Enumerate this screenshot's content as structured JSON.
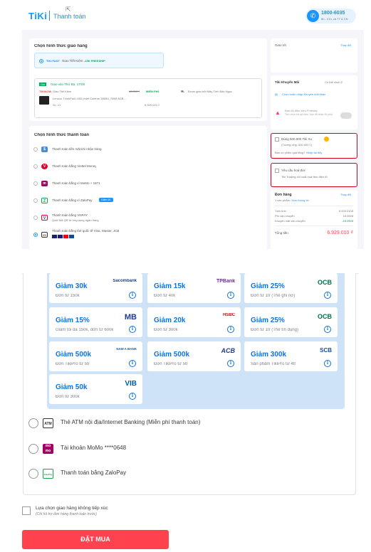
{
  "header": {
    "logo": "TiKi",
    "page_title": "Thanh toán",
    "hotline_number": "1800-6035",
    "hotline_sub": "8h - 21h, cả T7 & CN"
  },
  "shipping": {
    "title": "Chọn hình thức giao hàng",
    "method_brand": "TIKI FAST",
    "method_label": "Giao Tiết Kiệm",
    "method_discount": "-15K FREESHIP",
    "package": {
      "badge": "Gói",
      "date_label": "Giao vào Thứ Ba, 17/05",
      "brand": "TIKINOW",
      "ship_label": "Giao Tiết Kiệm",
      "ship_price": "18.000 ₫",
      "ship_free": "MIỄN PHÍ",
      "product_name": "Lenovo ThinkPad L460 (Intel Celeron 3865U, RAM 8GB,...",
      "qty": "SL: x1",
      "product_price": "6.929.010 ₫",
      "combine_note": "Được giao bởi Mây Tính Bảo Ngọc"
    }
  },
  "payment": {
    "title": "Chọn hình thức thanh toán",
    "methods": [
      {
        "label": "Thanh toán tiền mặt khi nhận hàng"
      },
      {
        "label": "Thanh toán bằng Viettel Money"
      },
      {
        "label": "Thanh toán bằng ví MoMo + 1871"
      },
      {
        "label": "Thanh toán bằng ví ZaloPay",
        "tag": "Giảm 1K"
      },
      {
        "label": "Thanh toán bằng VNPAY",
        "sub": "Quét Mã QR từ ứng dụng ngân hàng"
      },
      {
        "label": "Thanh toán bằng thẻ quốc tế Visa, Master, JCB"
      }
    ]
  },
  "right": {
    "ship_to_title": "Giao tới",
    "change": "Thay đổi",
    "promo_title": "Tiki Khuyến Mãi",
    "promo_count": "Có thể chọn 2",
    "promo_link": "Chọn hoặc nhập Khuyến mãi khác",
    "freeship_text": "Bạn đủ điều kiện Freeship",
    "freeship_sub": "Thử chọn khi gửi tiền, bạn đã nhận 90 phút",
    "tiki_xu_label": "Dùng 500.000 Tiki Xu",
    "tiki_xu_sub": "(Tương ứng: 500.000 ₫)",
    "gift_note": "Bạn có phiếu quà tặng?",
    "gift_link": "Nhập tại đây",
    "invoice_label": "Yêu cầu hoá đơn",
    "invoice_sub": "Tiki Trading chỉ xuất hoá đơn điện tử",
    "order_title": "Đơn hàng",
    "order_change": "Thay đổi",
    "order_items": "1 sản phẩm.",
    "order_detail": "Xem thông tin",
    "subtotal_label": "Tạm tính",
    "subtotal": "6.929.010đ",
    "shipfee_label": "Phí vận chuyển",
    "shipfee": "18.000đ",
    "shipdisc_label": "Khuyến mãi vận chuyển",
    "shipdisc": "-18.000đ",
    "total_label": "Tổng tiền",
    "total": "6.929.010 ₫"
  },
  "coupons": [
    {
      "title": "Giảm 30k",
      "sub": "Đơn từ 150k",
      "bank": "Sacombank"
    },
    {
      "title": "Giảm 15k",
      "sub": "Đơn từ 40k",
      "bank": "TPBank"
    },
    {
      "title": "Giảm 25%",
      "sub": "Đơn từ 1tr (Thẻ ghi nợ)",
      "bank": "OCB"
    },
    {
      "title": "Giảm 15%",
      "sub": "Giảm tối đa 150k, đơn từ 600k",
      "bank": "MB"
    },
    {
      "title": "Giảm 20k",
      "sub": "Đơn từ 300k",
      "bank": "HSBC"
    },
    {
      "title": "Giảm 25%",
      "sub": "Đơn từ 1tr (Thẻ tín dụng)",
      "bank": "OCB"
    },
    {
      "title": "Giảm 500k",
      "sub": "Đơn TikiPro từ 5tr",
      "bank": "NAM A BANK"
    },
    {
      "title": "Giảm 500k",
      "sub": "Đơn TikiPro từ 5tr",
      "bank": "ACB"
    },
    {
      "title": "Giảm 300k",
      "sub": "Sản phẩm TikiPro từ 4tr",
      "bank": "SCB"
    },
    {
      "title": "Giảm 50k",
      "sub": "Đơn từ 300k",
      "bank": "VIB"
    }
  ],
  "bottom_methods": [
    {
      "label": "Thẻ ATM nội địa/Internet Banking (Miễn phí thanh toán)",
      "icon": "ATM"
    },
    {
      "label": "Tài khoản MoMo ****0648",
      "icon": "mo mo"
    },
    {
      "label": "Thanh toán bằng ZaloPay",
      "icon": "ZaloPay"
    }
  ],
  "contactless": {
    "title": "Lựa chọn giao hàng không tiếp xúc",
    "sub": "(Chỉ hỗ trợ đơn hàng thanh toán trước)"
  },
  "buy_button": "ĐẶT MUA"
}
